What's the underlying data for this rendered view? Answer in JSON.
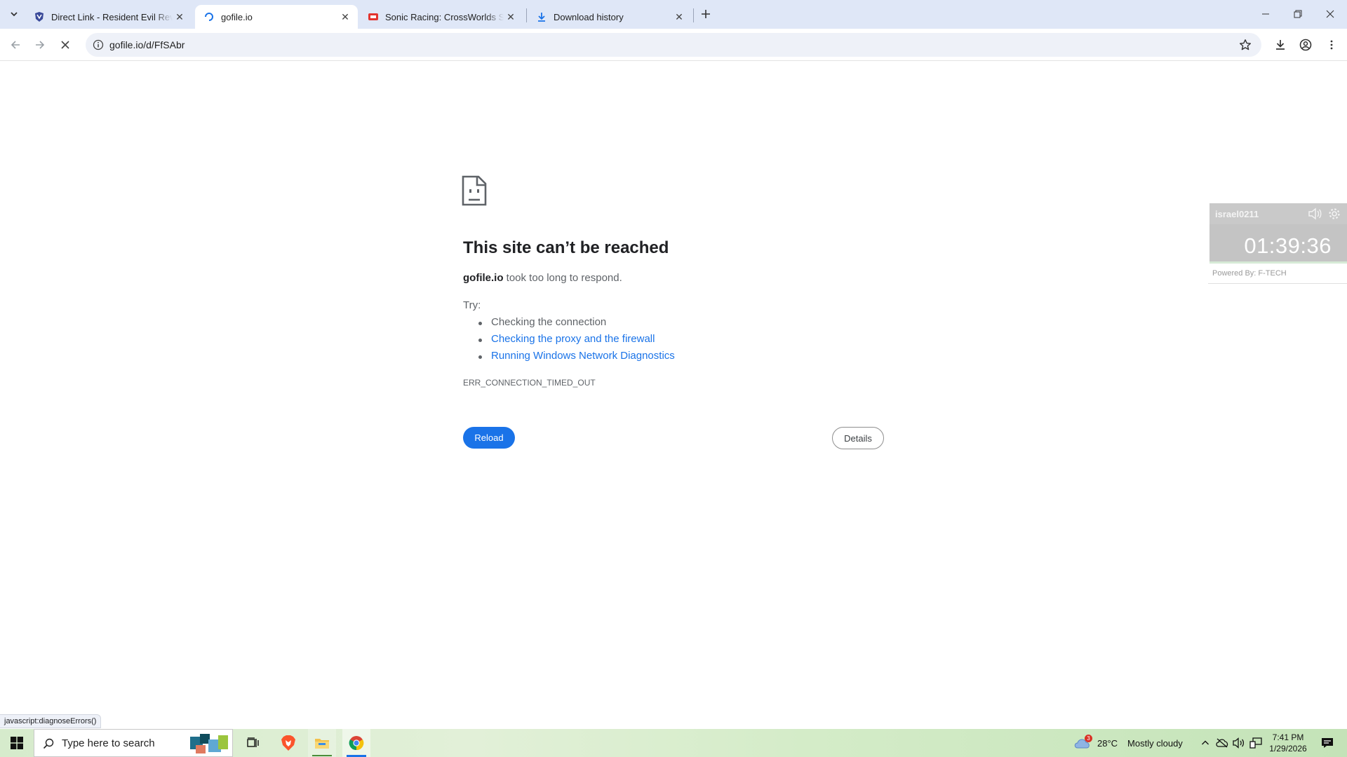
{
  "browser": {
    "tabs": [
      {
        "title": "Direct Link - Resident Evil Revel",
        "active": false
      },
      {
        "title": "gofile.io",
        "active": true
      },
      {
        "title": "Sonic Racing: CrossWorlds Switc",
        "active": false
      },
      {
        "title": "Download history",
        "active": false
      }
    ],
    "url": "gofile.io/d/FfSAbr"
  },
  "error_page": {
    "title": "This site can’t be reached",
    "host": "gofile.io",
    "message": " took too long to respond.",
    "try_label": "Try:",
    "suggestions": [
      "Checking the connection",
      "Checking the proxy and the firewall",
      "Running Windows Network Diagnostics"
    ],
    "error_code": "ERR_CONNECTION_TIMED_OUT",
    "reload_label": "Reload",
    "details_label": "Details"
  },
  "widget": {
    "username": "israel0211",
    "time": "01:39:36",
    "powered_by": "Powered By: F-TECH"
  },
  "status_bar": {
    "text": "javascript:diagnoseErrors()"
  },
  "taskbar": {
    "search_placeholder": "Type here to search",
    "weather_temp": "28°C",
    "weather_desc": "Mostly cloudy",
    "weather_badge": "3",
    "clock_time": "7:41 PM",
    "clock_date": "1/29/2026"
  },
  "colors": {
    "accent": "#1a73e8",
    "tabstrip": "#dfe7f7"
  }
}
